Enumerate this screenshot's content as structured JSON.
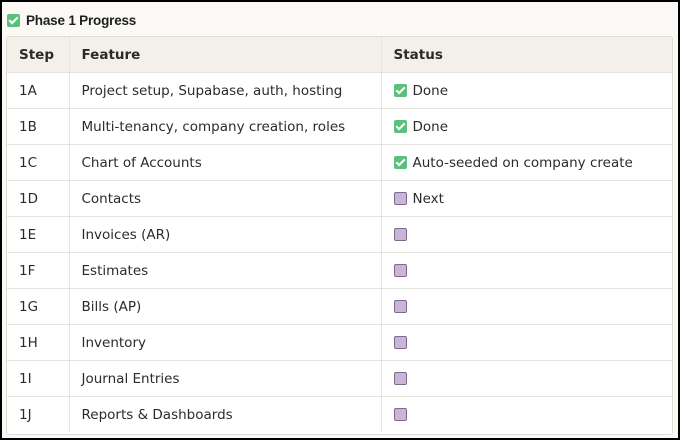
{
  "title": "Phase 1 Progress",
  "colors": {
    "done": "#5ac17c",
    "todo": "#c9b6d6",
    "header_bg": "#f2f0e9"
  },
  "table": {
    "headers": [
      "Step",
      "Feature",
      "Status"
    ],
    "rows": [
      {
        "step": "1A",
        "feature": "Project setup, Supabase, auth, hosting",
        "state": "done",
        "status_icon": "green-check-icon",
        "status": "Done"
      },
      {
        "step": "1B",
        "feature": "Multi-tenancy, company creation, roles",
        "state": "done",
        "status_icon": "green-check-icon",
        "status": "Done"
      },
      {
        "step": "1C",
        "feature": "Chart of Accounts",
        "state": "done",
        "status_icon": "green-check-icon",
        "status": "Auto-seeded on company create"
      },
      {
        "step": "1D",
        "feature": "Contacts",
        "state": "todo",
        "status_icon": "purple-square-icon",
        "status": "Next"
      },
      {
        "step": "1E",
        "feature": "Invoices (AR)",
        "state": "todo",
        "status_icon": "purple-square-icon",
        "status": ""
      },
      {
        "step": "1F",
        "feature": "Estimates",
        "state": "todo",
        "status_icon": "purple-square-icon",
        "status": ""
      },
      {
        "step": "1G",
        "feature": "Bills (AP)",
        "state": "todo",
        "status_icon": "purple-square-icon",
        "status": ""
      },
      {
        "step": "1H",
        "feature": "Inventory",
        "state": "todo",
        "status_icon": "purple-square-icon",
        "status": ""
      },
      {
        "step": "1I",
        "feature": "Journal Entries",
        "state": "todo",
        "status_icon": "purple-square-icon",
        "status": ""
      },
      {
        "step": "1J",
        "feature": "Reports & Dashboards",
        "state": "todo",
        "status_icon": "purple-square-icon",
        "status": ""
      }
    ]
  }
}
